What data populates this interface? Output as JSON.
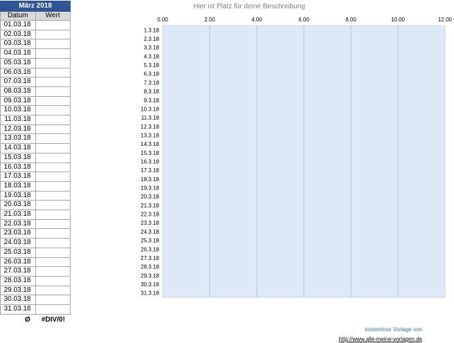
{
  "table": {
    "month": "März 2018",
    "col_date": "Datum",
    "col_value": "Wert",
    "rows": [
      {
        "date": "01.03.18",
        "value": ""
      },
      {
        "date": "02.03.18",
        "value": ""
      },
      {
        "date": "03.03.18",
        "value": ""
      },
      {
        "date": "04.03.18",
        "value": ""
      },
      {
        "date": "05.03.18",
        "value": ""
      },
      {
        "date": "06.03.18",
        "value": ""
      },
      {
        "date": "07.03.18",
        "value": ""
      },
      {
        "date": "08.03.18",
        "value": ""
      },
      {
        "date": "09.03.18",
        "value": ""
      },
      {
        "date": "10.03.18",
        "value": ""
      },
      {
        "date": "11.03.18",
        "value": ""
      },
      {
        "date": "12.03.18",
        "value": ""
      },
      {
        "date": "13.03.18",
        "value": ""
      },
      {
        "date": "14.03.18",
        "value": ""
      },
      {
        "date": "15.03.18",
        "value": ""
      },
      {
        "date": "16.03.18",
        "value": ""
      },
      {
        "date": "17.03.18",
        "value": ""
      },
      {
        "date": "18.03.18",
        "value": ""
      },
      {
        "date": "19.03.18",
        "value": ""
      },
      {
        "date": "20.03.18",
        "value": ""
      },
      {
        "date": "21.03.18",
        "value": ""
      },
      {
        "date": "22.03.18",
        "value": ""
      },
      {
        "date": "23.03.18",
        "value": ""
      },
      {
        "date": "24.03.18",
        "value": ""
      },
      {
        "date": "25.03.18",
        "value": ""
      },
      {
        "date": "26.03.18",
        "value": ""
      },
      {
        "date": "27.03.18",
        "value": ""
      },
      {
        "date": "28.03.18",
        "value": ""
      },
      {
        "date": "29.03.18",
        "value": ""
      },
      {
        "date": "30.03.18",
        "value": ""
      },
      {
        "date": "31.03.18",
        "value": ""
      }
    ],
    "avg_symbol": "Ø",
    "avg_value": "#DIV/0!"
  },
  "chart_data": {
    "type": "bar",
    "title": "Hier ist Platz für deine Beschreibung",
    "orientation": "horizontal",
    "categories": [
      "1.3.18",
      "2.3.18",
      "3.3.18",
      "4.3.18",
      "5.3.18",
      "6.3.18",
      "7.3.18",
      "8.3.18",
      "9.3.18",
      "10.3.18",
      "11.3.18",
      "12.3.18",
      "13.3.18",
      "14.3.18",
      "15.3.18",
      "16.3.18",
      "17.3.18",
      "18.3.18",
      "19.3.18",
      "20.3.18",
      "21.3.18",
      "22.3.18",
      "23.3.18",
      "24.3.18",
      "25.3.18",
      "26.3.18",
      "27.3.18",
      "28.3.18",
      "29.3.18",
      "30.3.18",
      "31.3.18"
    ],
    "values": [],
    "xlim": [
      0,
      12
    ],
    "ticks": [
      "0.00",
      "2.00",
      "4.00",
      "6.00",
      "8.00",
      "10.00",
      "12.00"
    ],
    "axis_position": "top",
    "grid": true,
    "plot_background": "#dde9f6",
    "grid_color": "#b4c7dc"
  },
  "footer": {
    "credit": "kostenlose Vorlage von",
    "link": "http://www.alle-meine-vorlagen.de"
  }
}
